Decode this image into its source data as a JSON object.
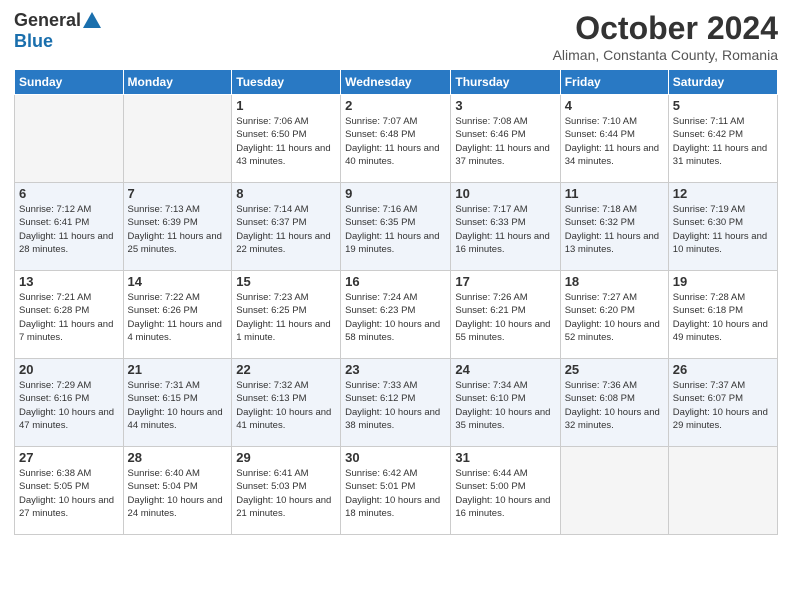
{
  "header": {
    "logo": {
      "general": "General",
      "blue": "Blue"
    },
    "title": "October 2024",
    "subtitle": "Aliman, Constanta County, Romania"
  },
  "weekdays": [
    "Sunday",
    "Monday",
    "Tuesday",
    "Wednesday",
    "Thursday",
    "Friday",
    "Saturday"
  ],
  "weeks": [
    [
      {
        "day": "",
        "info": ""
      },
      {
        "day": "",
        "info": ""
      },
      {
        "day": "1",
        "info": "Sunrise: 7:06 AM\nSunset: 6:50 PM\nDaylight: 11 hours and 43 minutes."
      },
      {
        "day": "2",
        "info": "Sunrise: 7:07 AM\nSunset: 6:48 PM\nDaylight: 11 hours and 40 minutes."
      },
      {
        "day": "3",
        "info": "Sunrise: 7:08 AM\nSunset: 6:46 PM\nDaylight: 11 hours and 37 minutes."
      },
      {
        "day": "4",
        "info": "Sunrise: 7:10 AM\nSunset: 6:44 PM\nDaylight: 11 hours and 34 minutes."
      },
      {
        "day": "5",
        "info": "Sunrise: 7:11 AM\nSunset: 6:42 PM\nDaylight: 11 hours and 31 minutes."
      }
    ],
    [
      {
        "day": "6",
        "info": "Sunrise: 7:12 AM\nSunset: 6:41 PM\nDaylight: 11 hours and 28 minutes."
      },
      {
        "day": "7",
        "info": "Sunrise: 7:13 AM\nSunset: 6:39 PM\nDaylight: 11 hours and 25 minutes."
      },
      {
        "day": "8",
        "info": "Sunrise: 7:14 AM\nSunset: 6:37 PM\nDaylight: 11 hours and 22 minutes."
      },
      {
        "day": "9",
        "info": "Sunrise: 7:16 AM\nSunset: 6:35 PM\nDaylight: 11 hours and 19 minutes."
      },
      {
        "day": "10",
        "info": "Sunrise: 7:17 AM\nSunset: 6:33 PM\nDaylight: 11 hours and 16 minutes."
      },
      {
        "day": "11",
        "info": "Sunrise: 7:18 AM\nSunset: 6:32 PM\nDaylight: 11 hours and 13 minutes."
      },
      {
        "day": "12",
        "info": "Sunrise: 7:19 AM\nSunset: 6:30 PM\nDaylight: 11 hours and 10 minutes."
      }
    ],
    [
      {
        "day": "13",
        "info": "Sunrise: 7:21 AM\nSunset: 6:28 PM\nDaylight: 11 hours and 7 minutes."
      },
      {
        "day": "14",
        "info": "Sunrise: 7:22 AM\nSunset: 6:26 PM\nDaylight: 11 hours and 4 minutes."
      },
      {
        "day": "15",
        "info": "Sunrise: 7:23 AM\nSunset: 6:25 PM\nDaylight: 11 hours and 1 minute."
      },
      {
        "day": "16",
        "info": "Sunrise: 7:24 AM\nSunset: 6:23 PM\nDaylight: 10 hours and 58 minutes."
      },
      {
        "day": "17",
        "info": "Sunrise: 7:26 AM\nSunset: 6:21 PM\nDaylight: 10 hours and 55 minutes."
      },
      {
        "day": "18",
        "info": "Sunrise: 7:27 AM\nSunset: 6:20 PM\nDaylight: 10 hours and 52 minutes."
      },
      {
        "day": "19",
        "info": "Sunrise: 7:28 AM\nSunset: 6:18 PM\nDaylight: 10 hours and 49 minutes."
      }
    ],
    [
      {
        "day": "20",
        "info": "Sunrise: 7:29 AM\nSunset: 6:16 PM\nDaylight: 10 hours and 47 minutes."
      },
      {
        "day": "21",
        "info": "Sunrise: 7:31 AM\nSunset: 6:15 PM\nDaylight: 10 hours and 44 minutes."
      },
      {
        "day": "22",
        "info": "Sunrise: 7:32 AM\nSunset: 6:13 PM\nDaylight: 10 hours and 41 minutes."
      },
      {
        "day": "23",
        "info": "Sunrise: 7:33 AM\nSunset: 6:12 PM\nDaylight: 10 hours and 38 minutes."
      },
      {
        "day": "24",
        "info": "Sunrise: 7:34 AM\nSunset: 6:10 PM\nDaylight: 10 hours and 35 minutes."
      },
      {
        "day": "25",
        "info": "Sunrise: 7:36 AM\nSunset: 6:08 PM\nDaylight: 10 hours and 32 minutes."
      },
      {
        "day": "26",
        "info": "Sunrise: 7:37 AM\nSunset: 6:07 PM\nDaylight: 10 hours and 29 minutes."
      }
    ],
    [
      {
        "day": "27",
        "info": "Sunrise: 6:38 AM\nSunset: 5:05 PM\nDaylight: 10 hours and 27 minutes."
      },
      {
        "day": "28",
        "info": "Sunrise: 6:40 AM\nSunset: 5:04 PM\nDaylight: 10 hours and 24 minutes."
      },
      {
        "day": "29",
        "info": "Sunrise: 6:41 AM\nSunset: 5:03 PM\nDaylight: 10 hours and 21 minutes."
      },
      {
        "day": "30",
        "info": "Sunrise: 6:42 AM\nSunset: 5:01 PM\nDaylight: 10 hours and 18 minutes."
      },
      {
        "day": "31",
        "info": "Sunrise: 6:44 AM\nSunset: 5:00 PM\nDaylight: 10 hours and 16 minutes."
      },
      {
        "day": "",
        "info": ""
      },
      {
        "day": "",
        "info": ""
      }
    ]
  ]
}
